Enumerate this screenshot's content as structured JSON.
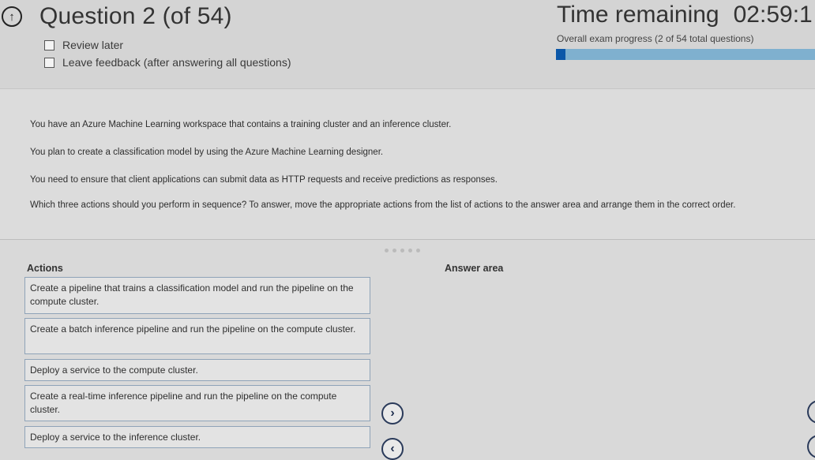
{
  "header": {
    "icon": "upload-circle-icon",
    "question_title": "Question 2 (of 54)",
    "review_later": "Review later",
    "leave_feedback": "Leave feedback (after answering all questions)",
    "time_label": "Time remaining",
    "time_value": "02:59:1",
    "progress_label": "Overall exam progress (2 of 54 total questions)",
    "progress_fraction": 0.037
  },
  "question": {
    "p1": "You have an Azure Machine Learning workspace that contains a training cluster and an inference cluster.",
    "p2": "You plan to create a classification model by using the Azure Machine Learning designer.",
    "p3": "You need to ensure that client applications can submit data as HTTP requests and receive predictions as responses.",
    "p4": "Which three actions should you perform in sequence? To answer, move the appropriate actions from the list of actions to the answer area and arrange them in the correct order."
  },
  "actions": {
    "title": "Actions",
    "items": [
      "Create a pipeline that trains a classification model and run the pipeline on the compute cluster.",
      "Create a batch inference pipeline and run the pipeline on the compute cluster.",
      "Deploy a service to the compute cluster.",
      "Create a real-time inference pipeline and run the pipeline on the compute cluster.",
      "Deploy a service to the inference cluster."
    ]
  },
  "answer_area": {
    "title": "Answer area"
  },
  "controls": {
    "move_right_icon": "chevron-right-icon",
    "move_left_icon": "chevron-left-icon"
  }
}
